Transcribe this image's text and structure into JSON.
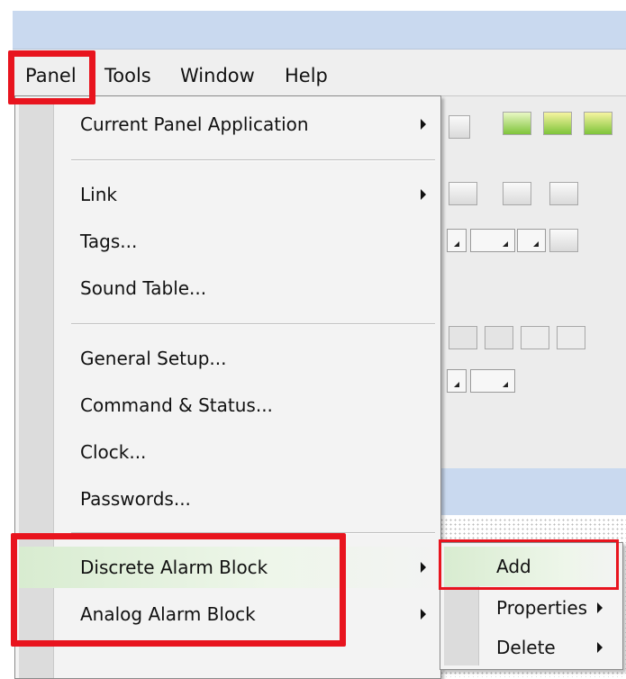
{
  "menubar": {
    "items": [
      "Panel",
      "Tools",
      "Window",
      "Help"
    ]
  },
  "panel_menu": {
    "items": [
      {
        "label": "Current Panel Application",
        "submenu": true
      },
      {
        "label": "Link",
        "submenu": true
      },
      {
        "label": "Tags...",
        "submenu": false
      },
      {
        "label": "Sound Table...",
        "submenu": false
      },
      {
        "label": "General Setup...",
        "submenu": false
      },
      {
        "label": "Command & Status...",
        "submenu": false
      },
      {
        "label": "Clock...",
        "submenu": false
      },
      {
        "label": "Passwords...",
        "submenu": false
      },
      {
        "label": "Discrete Alarm Block",
        "submenu": true,
        "highlighted": true
      },
      {
        "label": "Analog Alarm Block",
        "submenu": true
      }
    ]
  },
  "alarm_submenu": {
    "items": [
      {
        "label": "Add",
        "highlighted": true
      },
      {
        "label": "Properties",
        "submenu": true
      },
      {
        "label": "Delete",
        "submenu": true
      }
    ]
  },
  "colors": {
    "highlight_box": "#e8141e",
    "title_blue": "#c9d9ef",
    "menu_bg": "#f3f3f3"
  }
}
